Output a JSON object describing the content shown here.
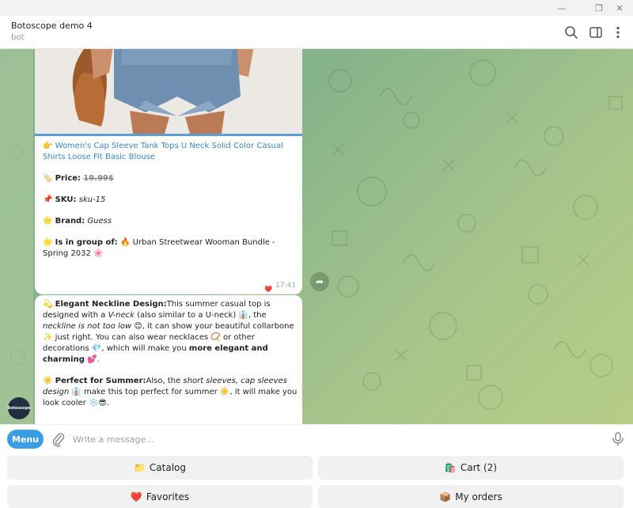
{
  "chat": {
    "title": "Botoscope demo 4",
    "subtitle": "bot"
  },
  "product": {
    "name_prefix": "👉",
    "name": "Women's Cap Sleeve Tank Tops U Neck Solid Color Casual Shirts Loose Fit Basic Blouse",
    "price_icon": "🏷️",
    "price_label": "Price:",
    "price_value": "19.99$",
    "sku_icon": "📌",
    "sku_label": "SKU:",
    "sku_value": "sku-15",
    "brand_icon": "🌟",
    "brand_label": "Brand:",
    "brand_value": "Guess",
    "group_icon": "🌟",
    "group_label": "Is in group of:",
    "group_value": "🔥 Urban Streetwear Wooman Bundle - Spring 2032 🌸",
    "time": "17:41",
    "reaction": "❤️"
  },
  "description": {
    "p1_icon": "💫",
    "p1_title": "Elegant Neckline Design:",
    "p1_a": "This summer casual top is designed with a ",
    "p1_vneck": "V-neck",
    "p1_b": " (also similar to a U-neck) 👔, the ",
    "p1_neckline": "neckline is not too low",
    "p1_c": " 😊, it can show your beautiful collarbone ✨ just right. You can also wear necklaces 📿 or other decorations 💎, which will make you ",
    "p1_bold": "more elegant and charming",
    "p1_d": " 💕.",
    "p2_icon": "☀️",
    "p2_title": "Perfect for Summer:",
    "p2_a": "Also, the ",
    "p2_italic": "short sleeves, cap sleeves design",
    "p2_b": " 👔 make this top perfect for summer ☀️, it will make you look cooler ❄️😎."
  },
  "avatar": {
    "label": "Botoscope"
  },
  "composer": {
    "menu_label": "Menu",
    "placeholder": "Write a message..."
  },
  "keyboard": {
    "catalog": {
      "icon": "📁",
      "label": "Catalog"
    },
    "cart": {
      "icon": "🛍️",
      "label": "Cart (2)"
    },
    "favorites": {
      "icon": "❤️",
      "label": "Favorites"
    },
    "orders": {
      "icon": "📦",
      "label": "My orders"
    }
  },
  "icons": {
    "minimize": "minimize-icon",
    "maximize": "maximize-icon",
    "close": "close-icon",
    "search": "search-icon",
    "sidebar": "sidebar-toggle-icon",
    "more": "more-vertical-icon",
    "attach": "paperclip-icon",
    "mic": "microphone-icon",
    "share": "share-arrow-icon"
  },
  "colors": {
    "accent": "#3a9ee4",
    "link": "#3a86c8",
    "keyboard_button": "#f1f1f1"
  }
}
